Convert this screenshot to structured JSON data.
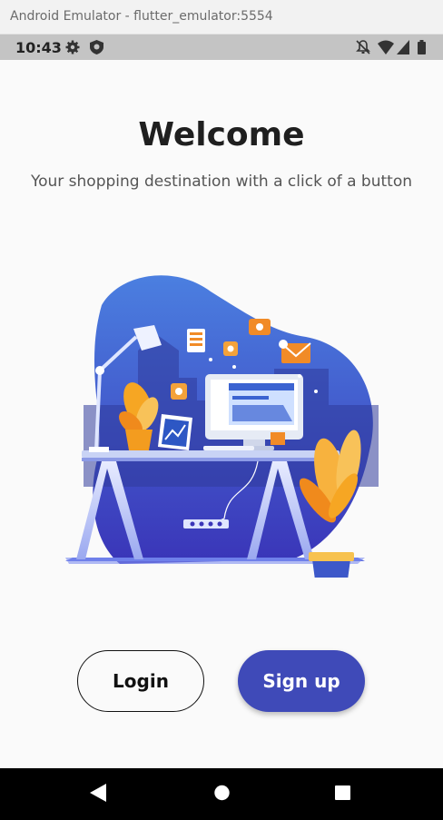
{
  "window": {
    "title": "Android Emulator - flutter_emulator:5554"
  },
  "status_bar": {
    "time": "10:43",
    "left_icons": [
      "gear-icon",
      "shield-icon"
    ],
    "right_icons": [
      "notifications-off-icon",
      "wifi-icon",
      "signal-icon",
      "battery-icon"
    ]
  },
  "main": {
    "title": "Welcome",
    "subtitle": "Your shopping destination with a click of a button",
    "illustration": "workspace-illustration"
  },
  "actions": {
    "login_label": "Login",
    "signup_label": "Sign up"
  },
  "nav_bar": {
    "buttons": [
      "back-icon",
      "home-icon",
      "recents-icon"
    ]
  },
  "colors": {
    "primary": "#3f4ab8",
    "background": "#fafafa",
    "text": "#1f1f1f"
  }
}
